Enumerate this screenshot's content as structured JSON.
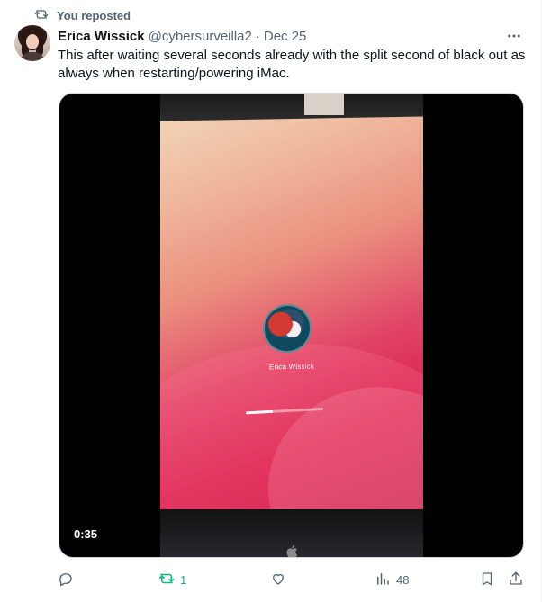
{
  "repost_label": "You reposted",
  "author": {
    "name": "Erica Wissick",
    "handle": "@cybersurveilla2",
    "date": "Dec 25"
  },
  "tweet_text": "This after waiting several seconds already with the split second of black out as always when restarting/powering iMac.",
  "media": {
    "login_name": "Erica Wissick",
    "duration": "0:35",
    "progress": 0.35
  },
  "actions": {
    "replies": "",
    "reposts": "1",
    "likes": "",
    "views": "48"
  },
  "colors": {
    "text_primary": "#0f1419",
    "text_secondary": "#536471",
    "repost_active": "#00ba7c"
  },
  "icons": [
    "repost-icon",
    "more-icon",
    "reply-icon",
    "like-icon",
    "views-icon",
    "bookmark-icon",
    "share-icon",
    "apple-logo-icon"
  ]
}
